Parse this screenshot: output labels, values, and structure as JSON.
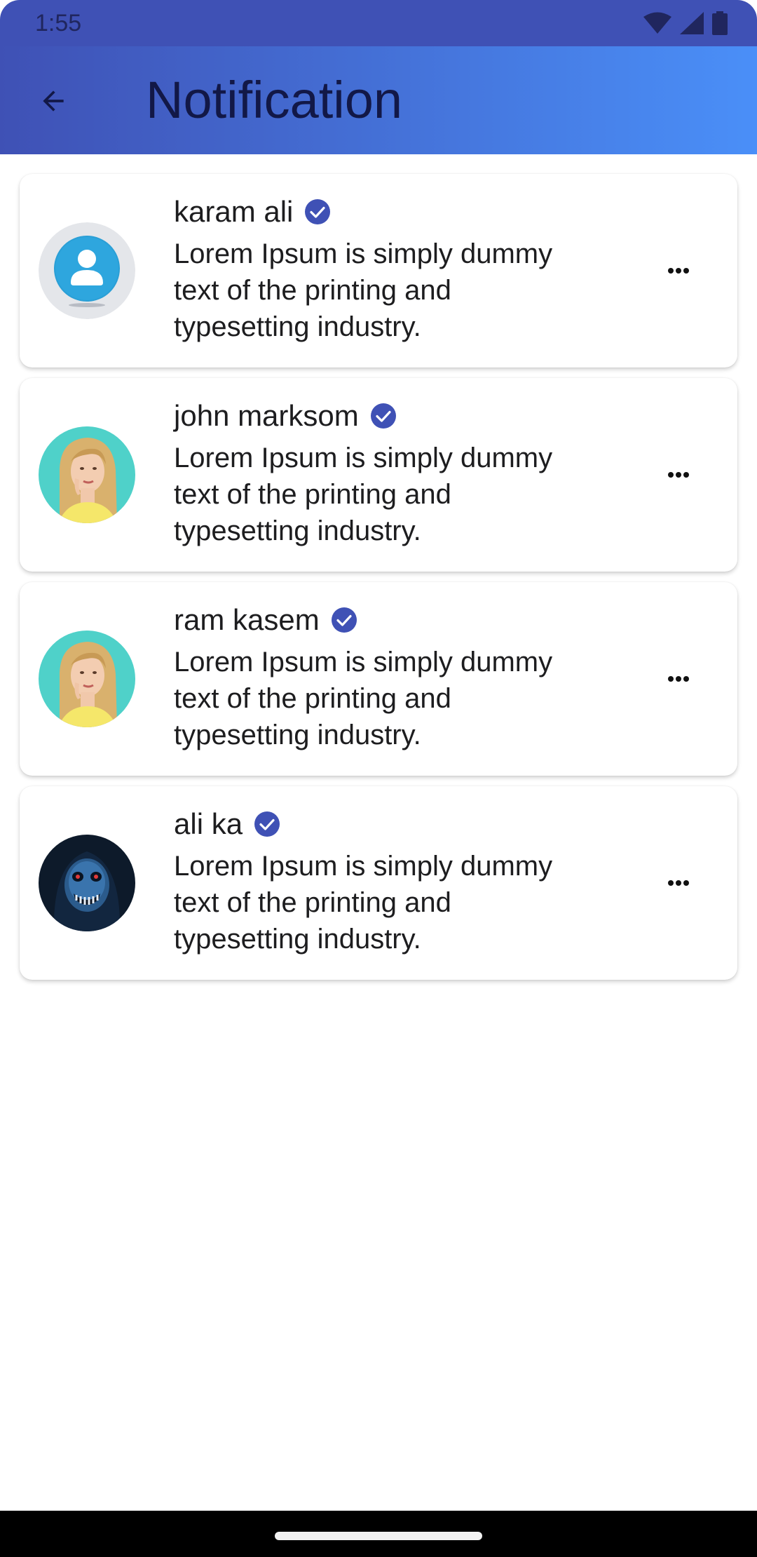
{
  "status_bar": {
    "time": "1:55",
    "icons": [
      "wifi-icon",
      "signal-icon",
      "battery-icon"
    ]
  },
  "app_bar": {
    "title": "Notification",
    "back_icon": "arrow-back-icon",
    "gradient": [
      "#3f51b5",
      "#4a8ff8"
    ]
  },
  "notifications": [
    {
      "name": "karam ali",
      "message": "Lorem Ipsum is simply dummy text of the printing and typesetting industry.",
      "avatar": "default-user-avatar",
      "verified": true
    },
    {
      "name": "john marksom",
      "message": "Lorem Ipsum is simply dummy text of the printing and typesetting industry.",
      "avatar": "woman-photo-avatar",
      "verified": true
    },
    {
      "name": "ram kasem",
      "message": "Lorem Ipsum is simply dummy text of the printing and typesetting industry.",
      "avatar": "woman-photo-avatar",
      "verified": true
    },
    {
      "name": "ali ka",
      "message": "Lorem Ipsum is simply dummy text of the printing and typesetting industry.",
      "avatar": "dark-skull-avatar",
      "verified": true
    }
  ],
  "colors": {
    "primary": "#3f51b5",
    "accent": "#4a8ff8",
    "verified_badge": "#3f51b5",
    "title_text": "#121847"
  }
}
